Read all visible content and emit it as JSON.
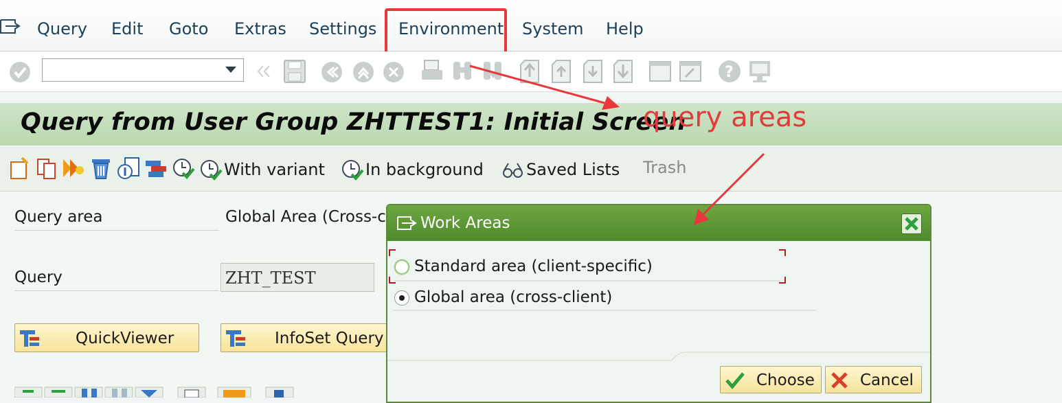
{
  "menubar": {
    "items": [
      {
        "label": "Query"
      },
      {
        "label": "Edit"
      },
      {
        "label": "Goto"
      },
      {
        "label": "Extras"
      },
      {
        "label": "Settings"
      },
      {
        "label": "Environment"
      },
      {
        "label": "System"
      },
      {
        "label": "Help"
      }
    ]
  },
  "command_field": {
    "value": ""
  },
  "screen": {
    "title": "Query from User Group ZHTTEST1: Initial Screen"
  },
  "annotation": {
    "text": "query areas",
    "color": "#e23b3b"
  },
  "app_toolbar": {
    "with_variant": "With variant",
    "in_background": "In background",
    "saved_lists": "Saved Lists",
    "trash": "Trash"
  },
  "form": {
    "query_area_label": "Query area",
    "query_area_value": "Global Area (Cross-cl",
    "query_label": "Query",
    "query_value": "ZHT_TEST",
    "quickviewer_button": "QuickViewer",
    "infoset_query_button": "InfoSet Query"
  },
  "dialog": {
    "title": "Work Areas",
    "options": [
      {
        "label": "Standard area (client-specific)",
        "selected": false
      },
      {
        "label": "Global area (cross-client)",
        "selected": true
      }
    ],
    "choose_button": "Choose",
    "cancel_button": "Cancel"
  },
  "colors": {
    "title_bar": "#c3ddb9",
    "dialog_header": "#5a952f",
    "highlight": "#e8383b",
    "button_face": "#f7e49a"
  }
}
